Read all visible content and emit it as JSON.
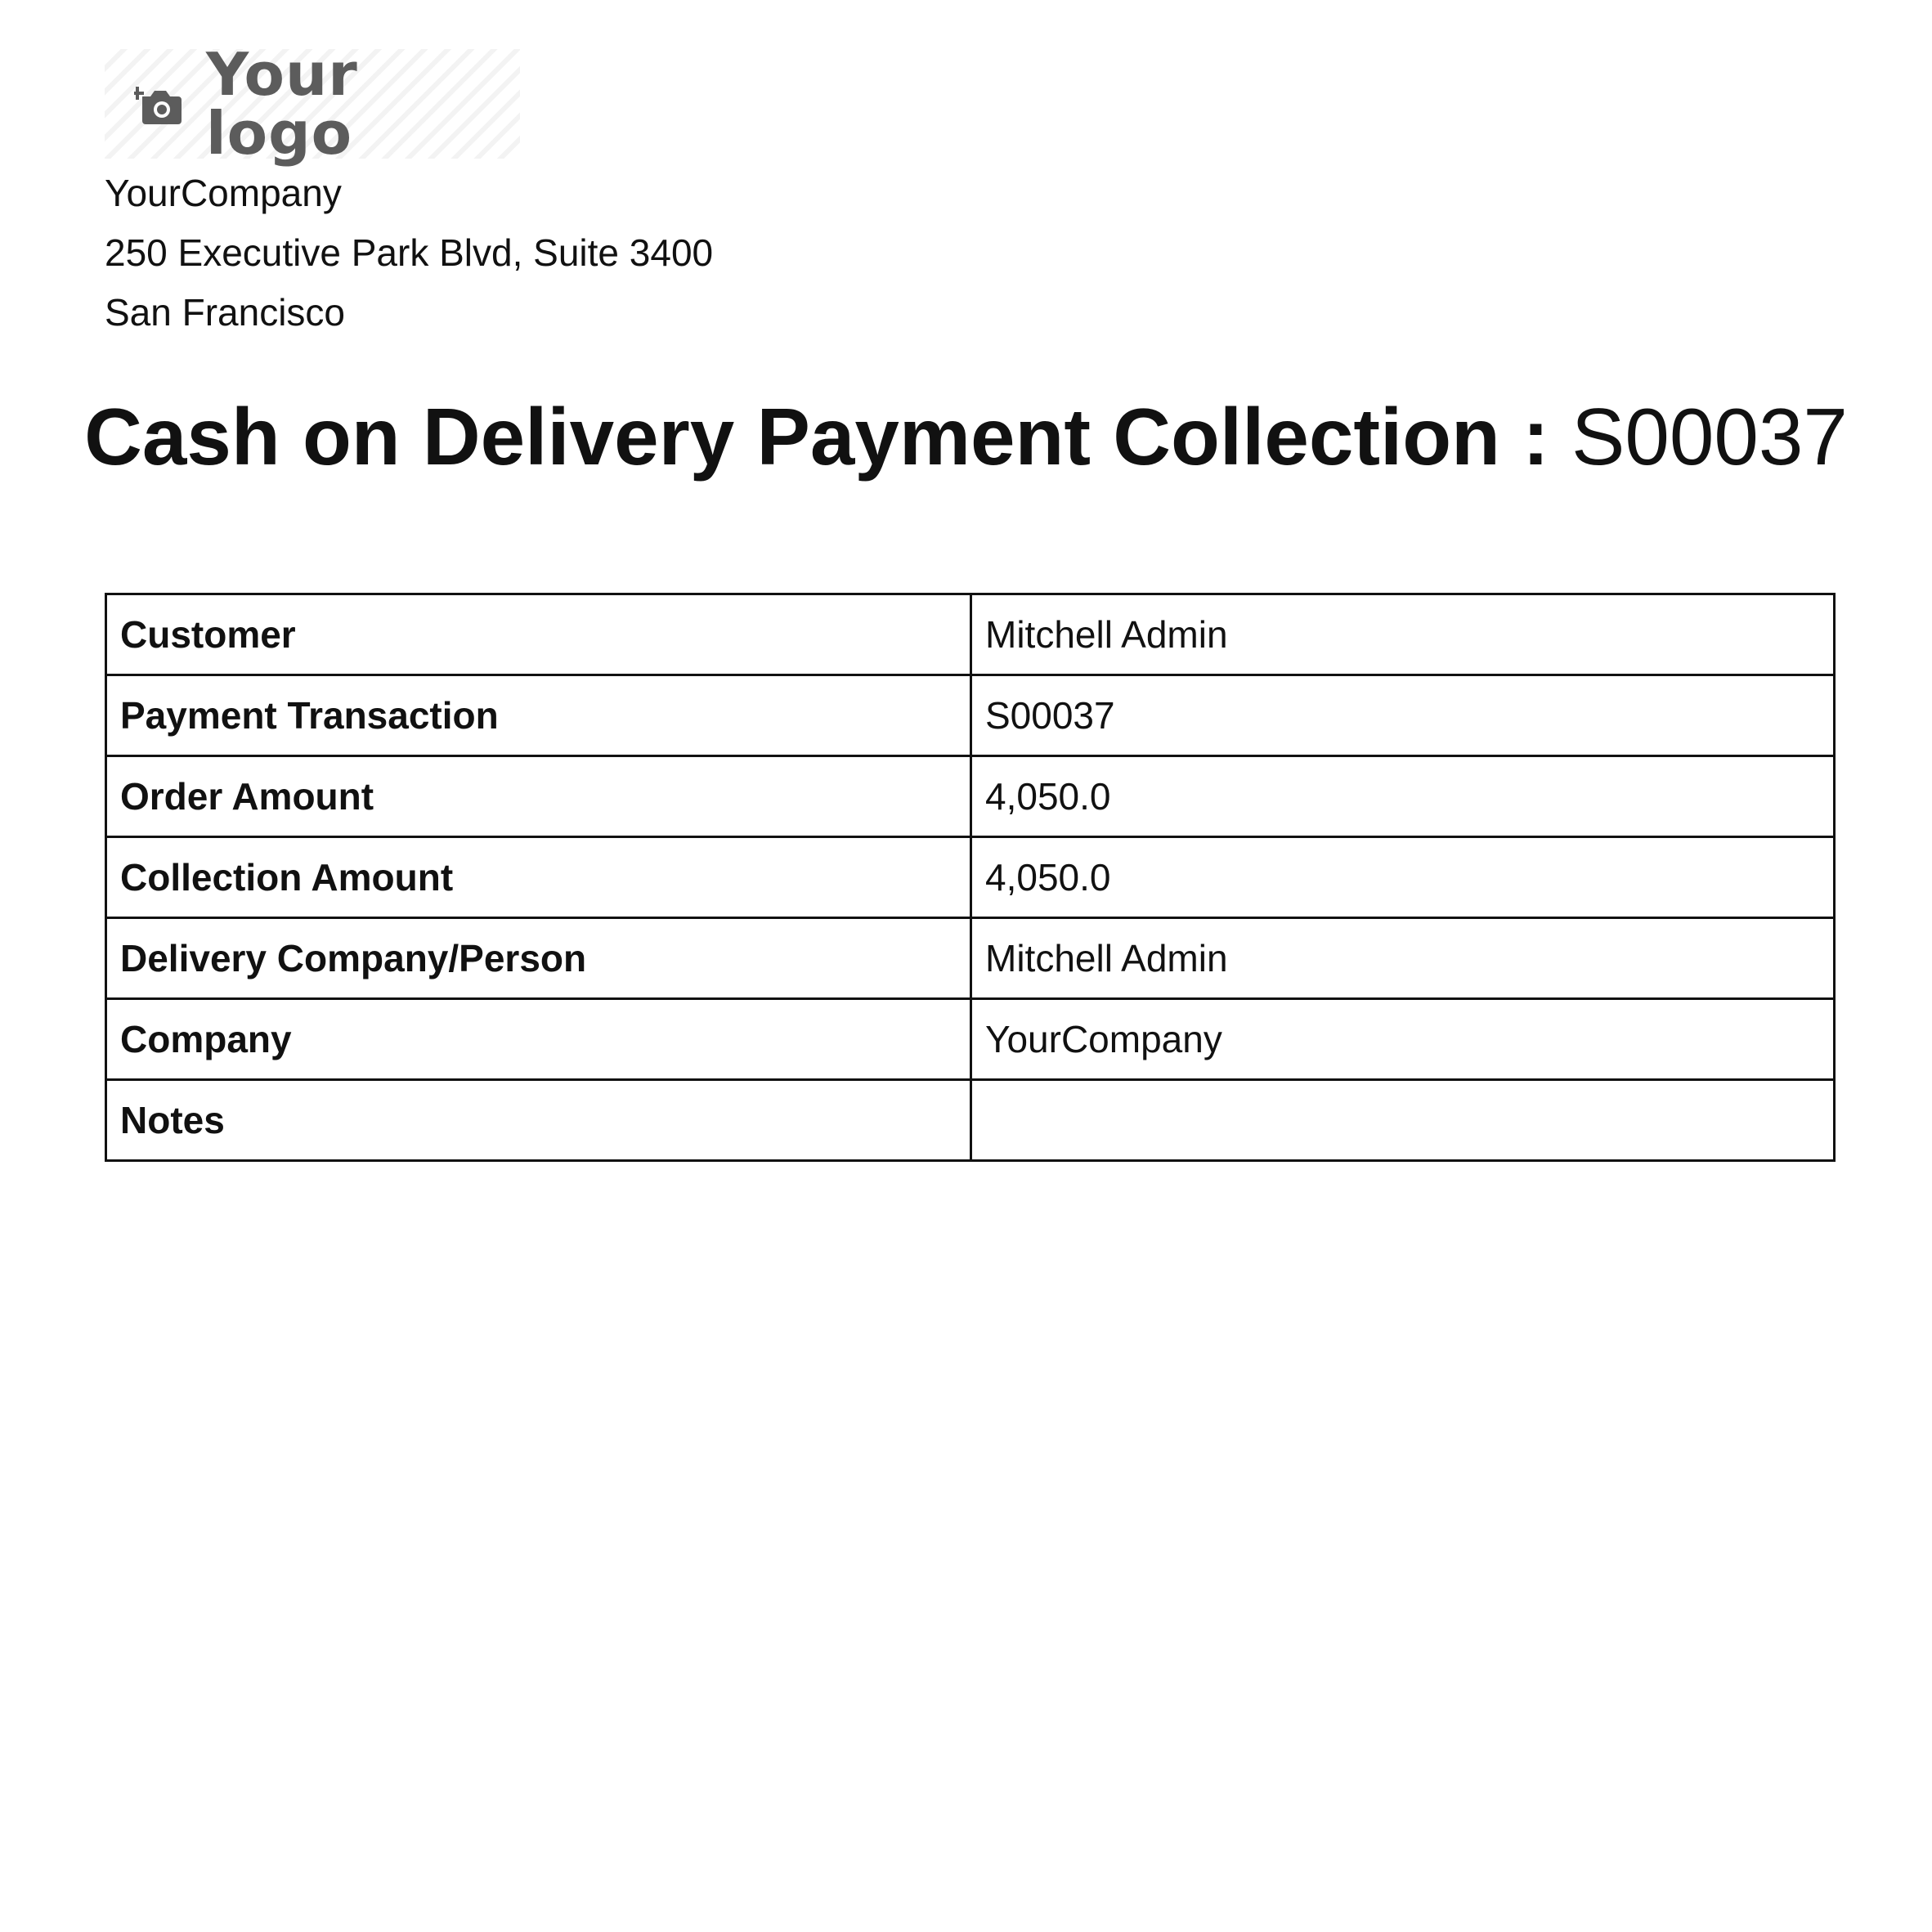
{
  "logo": {
    "text": "Your logo",
    "icon": "camera-add-icon"
  },
  "company": {
    "name": "YourCompany",
    "address_line": "250 Executive Park Blvd, Suite 3400",
    "city": "San Francisco"
  },
  "title": {
    "main": "Cash on Delivery Payment Collection :",
    "reference": "S00037"
  },
  "details": {
    "customer_label": "Customer",
    "customer_value": "Mitchell Admin",
    "transaction_label": "Payment Transaction",
    "transaction_value": "S00037",
    "order_amount_label": "Order Amount",
    "order_amount_value": "4,050.0",
    "collection_amount_label": "Collection Amount",
    "collection_amount_value": "4,050.0",
    "delivery_label": "Delivery Company/Person",
    "delivery_value": "Mitchell Admin",
    "company_label": "Company",
    "company_value": "YourCompany",
    "notes_label": "Notes",
    "notes_value": ""
  }
}
